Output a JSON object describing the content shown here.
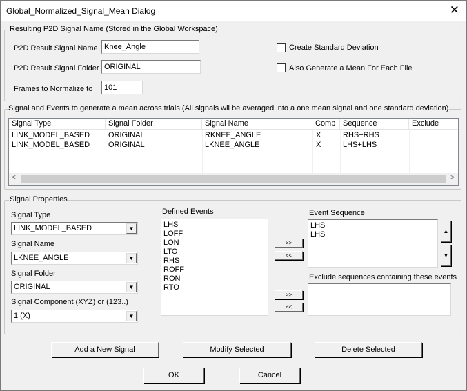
{
  "window": {
    "title": "Global_Normalized_Signal_Mean Dialog",
    "close_glyph": "✕"
  },
  "result_group": {
    "label": "Resulting P2D Signal Name (Stored in the Global Workspace)",
    "signal_name_label": "P2D Result Signal Name",
    "signal_name_value": "Knee_Angle",
    "signal_folder_label": "P2D Result Signal Folder",
    "signal_folder_value": "ORIGINAL",
    "frames_label": "Frames to Normalize to",
    "frames_value": "101",
    "create_std_label": "Create Standard Deviation",
    "create_std_checked": false,
    "mean_each_file_label": "Also Generate a Mean For Each File",
    "mean_each_file_checked": false
  },
  "signals_group": {
    "label": "Signal and Events to generate a mean across trials (All signals wil be averaged into a one mean signal and one standard deviation)",
    "columns": [
      "Signal Type",
      "Signal Folder",
      "Signal Name",
      "Comp",
      "Sequence",
      "Exclude"
    ],
    "rows": [
      [
        "LINK_MODEL_BASED",
        "ORIGINAL",
        "RKNEE_ANGLE",
        "X",
        "RHS+RHS",
        ""
      ],
      [
        "LINK_MODEL_BASED",
        "ORIGINAL",
        "LKNEE_ANGLE",
        "X",
        "LHS+LHS",
        ""
      ]
    ],
    "scroll_left_glyph": "<",
    "scroll_right_glyph": ">"
  },
  "props_group": {
    "label": "Signal Properties",
    "signal_type_label": "Signal Type",
    "signal_type_value": "LINK_MODEL_BASED",
    "signal_name_label": "Signal Name",
    "signal_name_value": "LKNEE_ANGLE",
    "signal_folder_label": "Signal Folder",
    "signal_folder_value": "ORIGINAL",
    "component_label": "Signal Component (XYZ) or (123..)",
    "component_value": "1 (X)",
    "defined_events_label": "Defined Events",
    "defined_events": [
      "LHS",
      "LOFF",
      "LON",
      "LTO",
      "RHS",
      "ROFF",
      "RON",
      "RTO"
    ],
    "event_sequence_label": "Event Sequence",
    "event_sequence": [
      "LHS",
      "LHS"
    ],
    "exclude_label": "Exclude sequences containing these events",
    "exclude_events": [],
    "add_arrow": ">>",
    "remove_arrow": "<<",
    "up_glyph": "▲",
    "down_glyph": "▼",
    "dropdown_glyph": "▼"
  },
  "actions": {
    "add_signal": "Add a New Signal",
    "modify_selected": "Modify Selected",
    "delete_selected": "Delete Selected",
    "ok": "OK",
    "cancel": "Cancel"
  }
}
